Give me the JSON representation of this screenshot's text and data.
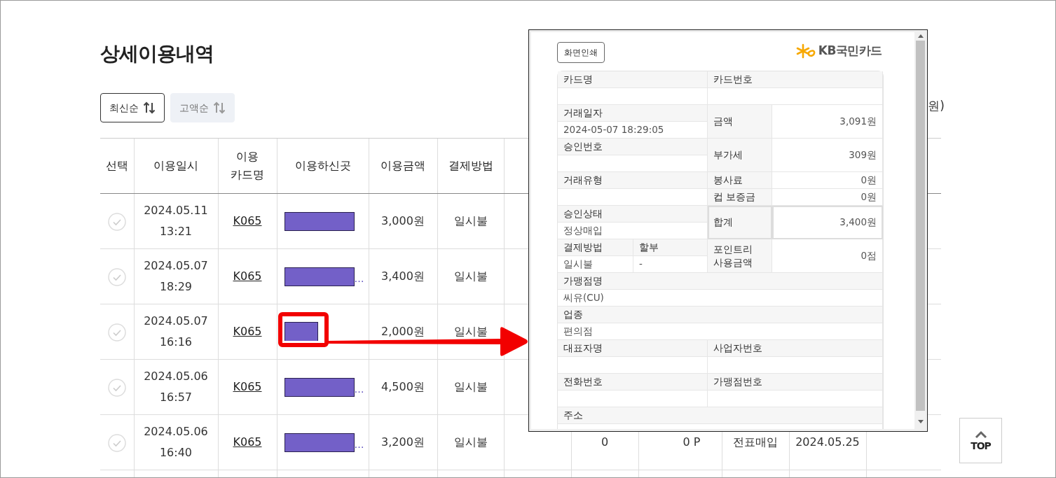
{
  "page": {
    "title": "상세이용내역",
    "unit_note": "원)"
  },
  "sort_options": [
    {
      "label": "최신순",
      "selected": true
    },
    {
      "label": "고액순",
      "selected": false
    }
  ],
  "table": {
    "columns": [
      "선택",
      "이용일시",
      "이용\n카드명",
      "이용하신곳",
      "이용금액",
      "결제방법"
    ],
    "rows": [
      {
        "selected": false,
        "datetime": "2024.05.11\n13:21",
        "card": "K065",
        "merchant": {
          "kind": "long"
        },
        "amount": "3,000원",
        "method": "일시불"
      },
      {
        "selected": false,
        "datetime": "2024.05.07\n18:29",
        "card": "K065",
        "merchant": {
          "kind": "long",
          "text": "…"
        },
        "amount": "3,400원",
        "method": "일시불"
      },
      {
        "selected": false,
        "datetime": "2024.05.07\n16:16",
        "card": "K065",
        "merchant": {
          "kind": "short",
          "highlighted": true
        },
        "amount": "2,000원",
        "method": "일시불"
      },
      {
        "selected": false,
        "datetime": "2024.05.06\n16:57",
        "card": "K065",
        "merchant": {
          "kind": "long",
          "text": "…"
        },
        "amount": "4,500원",
        "method": "일시불"
      },
      {
        "selected": false,
        "datetime": "2024.05.06\n16:40",
        "card": "K065",
        "merchant": {
          "kind": "long",
          "text": "…"
        },
        "amount": "3,200원",
        "method": "일시불",
        "column_8": "0",
        "column_9": "0 P",
        "column_10": "전표매입",
        "column_11": "2024.05.25"
      }
    ]
  },
  "popup": {
    "print_button": "화면인쇄",
    "logo_text": "KB국민카드",
    "fields": [
      {
        "kind": "stacked",
        "label": "카드명"
      },
      {
        "kind": "stacked",
        "label": "카드번호"
      },
      {
        "kind": "stacked",
        "label": "거래일자",
        "value": "2024-05-07 18:29:05"
      },
      {
        "kind": "side",
        "label": "금액",
        "value": "3,091원",
        "emphasized": false
      },
      {
        "kind": "stacked",
        "label": "승인번호"
      },
      {
        "kind": "side",
        "label": "부가세",
        "value": "309원",
        "emphasized": false
      },
      {
        "kind": "stacked",
        "label": "거래유형"
      },
      {
        "kind": "side",
        "label": "봉사료",
        "value": "0원",
        "emphasized": false
      },
      {
        "kind": "side",
        "label": "컵 보증금",
        "value": "0원",
        "emphasized": false
      },
      {
        "kind": "stacked",
        "label": "승인상태",
        "value": "정상매입"
      },
      {
        "kind": "side",
        "label": "합계",
        "value": "3,400원",
        "emphasized": true
      },
      {
        "kind": "stacked",
        "label": "결제방법",
        "value": "일시불"
      },
      {
        "kind": "stacked",
        "label": "할부",
        "value": "-"
      },
      {
        "kind": "side",
        "label": "포인트리\n사용금액",
        "value": "0점",
        "emphasized": false
      },
      {
        "kind": "stacked",
        "label": "가맹점명",
        "value": "씨유(CU)"
      },
      {
        "kind": "stacked",
        "label": "업종",
        "value": "편의점"
      },
      {
        "kind": "stacked",
        "label": "대표자명"
      },
      {
        "kind": "stacked",
        "label": "사업자번호"
      },
      {
        "kind": "stacked",
        "label": "전화번호"
      },
      {
        "kind": "stacked",
        "label": "가맹점번호"
      },
      {
        "kind": "stacked",
        "label": "주소"
      }
    ]
  },
  "top_button": "TOP"
}
